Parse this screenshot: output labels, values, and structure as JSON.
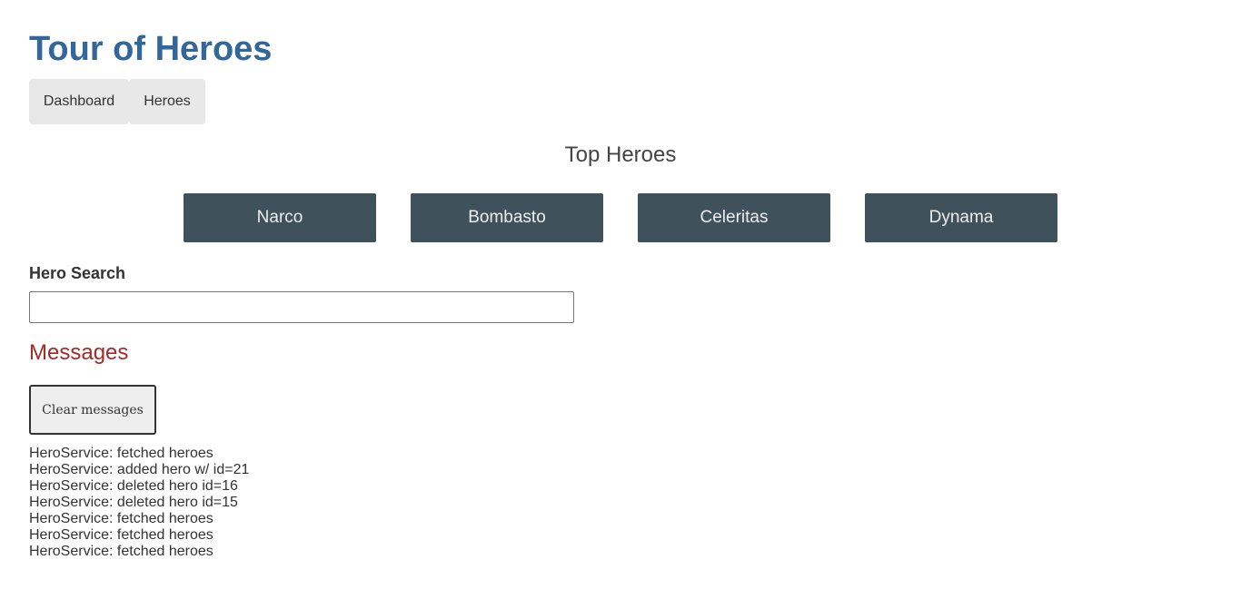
{
  "app": {
    "title": "Tour of Heroes"
  },
  "nav": {
    "items": [
      {
        "label": "Dashboard"
      },
      {
        "label": "Heroes"
      }
    ]
  },
  "dashboard": {
    "title": "Top Heroes",
    "heroes": [
      {
        "name": "Narco"
      },
      {
        "name": "Bombasto"
      },
      {
        "name": "Celeritas"
      },
      {
        "name": "Dynama"
      }
    ]
  },
  "search": {
    "label": "Hero Search",
    "value": ""
  },
  "messages": {
    "title": "Messages",
    "clear_label": "Clear messages",
    "items": [
      "HeroService: fetched heroes",
      "HeroService: added hero w/ id=21",
      "HeroService: deleted hero id=16",
      "HeroService: deleted hero id=15",
      "HeroService: fetched heroes",
      "HeroService: fetched heroes",
      "HeroService: fetched heroes"
    ]
  },
  "colors": {
    "title": "#336699",
    "hero_tile": "#3f525c",
    "messages_title": "#a52a2a",
    "nav_bg": "#e8e8e8"
  }
}
